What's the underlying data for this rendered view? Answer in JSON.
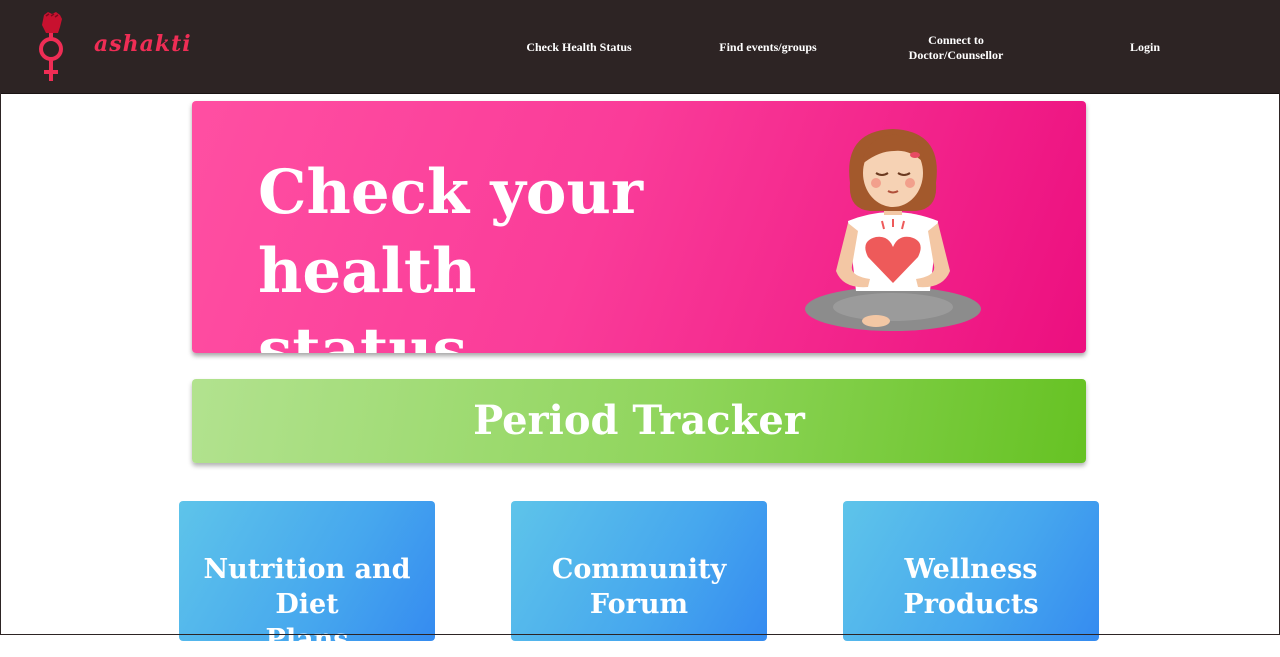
{
  "brand": {
    "name": "ashakti"
  },
  "nav": {
    "check_health": "Check Health Status",
    "find_events": "Find events/groups",
    "connect_line1": "Connect to",
    "connect_line2": "Doctor/Counsellor",
    "login": "Login"
  },
  "hero": {
    "title_line1": "Check your",
    "title_line2": "health status",
    "illustration": "meditating-woman-with-heart-icon"
  },
  "period": {
    "label": "Period Tracker"
  },
  "cards": [
    {
      "line1": "Nutrition and Diet",
      "line2": "Plans"
    },
    {
      "line1": "Community",
      "line2": "Forum"
    },
    {
      "line1": "Wellness",
      "line2": "Products"
    }
  ],
  "colors": {
    "navbar": "#2d2424",
    "brand": "#ef2d55",
    "hero_pink": "#fa3c99",
    "tracker_green": "#8fd55b",
    "card_blue": "#46a7ee"
  }
}
